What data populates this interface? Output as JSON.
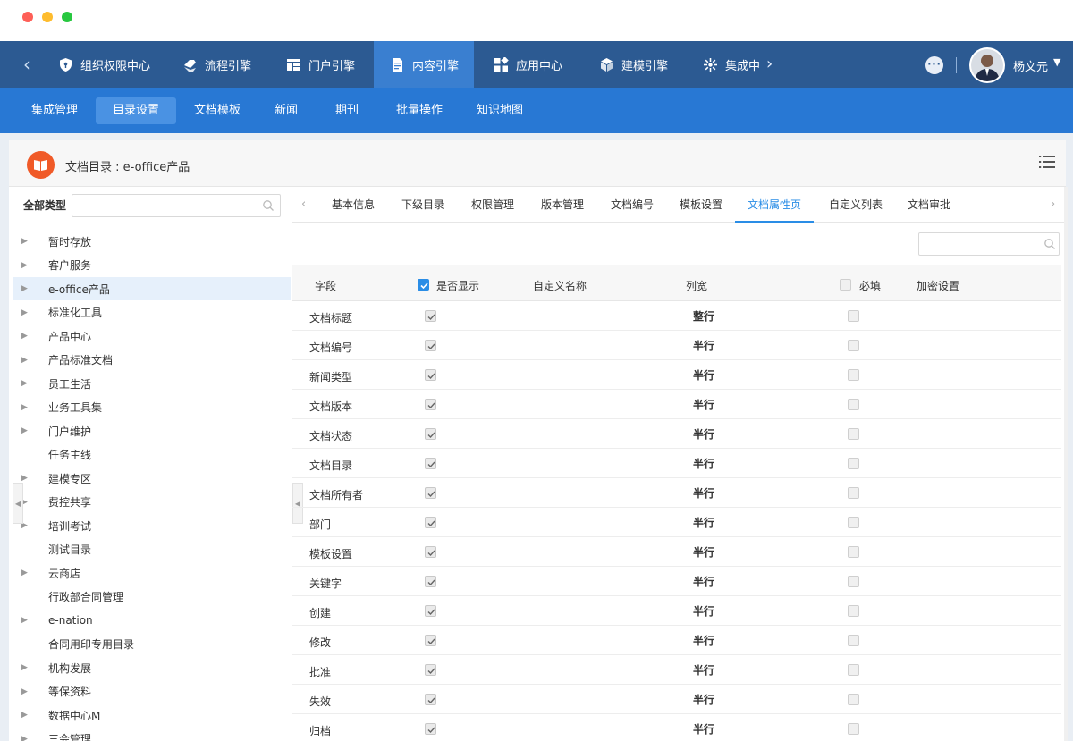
{
  "topnav": {
    "items": [
      {
        "label": "组织权限中心",
        "icon": "shield-icon"
      },
      {
        "label": "流程引擎",
        "icon": "workflow-icon"
      },
      {
        "label": "门户引擎",
        "icon": "portal-icon"
      },
      {
        "label": "内容引擎",
        "icon": "document-icon",
        "active": true
      },
      {
        "label": "应用中心",
        "icon": "apps-icon"
      },
      {
        "label": "建模引擎",
        "icon": "cube-icon"
      },
      {
        "label": "集成中",
        "icon": "integration-icon"
      }
    ],
    "user_name": "杨文元",
    "chat_icon": "more-dots-icon"
  },
  "subnav": {
    "items": [
      {
        "label": "集成管理"
      },
      {
        "label": "目录设置",
        "active": true
      },
      {
        "label": "文档模板"
      },
      {
        "label": "新闻"
      },
      {
        "label": "期刊"
      },
      {
        "label": "批量操作"
      },
      {
        "label": "知识地图"
      }
    ]
  },
  "panel": {
    "title": "文档目录 : e-office产品"
  },
  "tree": {
    "label": "全部类型",
    "search_placeholder": "",
    "items": [
      {
        "label": "暂时存放",
        "expandable": true
      },
      {
        "label": "客户服务",
        "expandable": true
      },
      {
        "label": "e-office产品",
        "expandable": true,
        "selected": true
      },
      {
        "label": "标准化工具",
        "expandable": true
      },
      {
        "label": "产品中心",
        "expandable": true
      },
      {
        "label": "产品标准文档",
        "expandable": true
      },
      {
        "label": "员工生活",
        "expandable": true
      },
      {
        "label": "业务工具集",
        "expandable": true
      },
      {
        "label": "门户维护",
        "expandable": true
      },
      {
        "label": "任务主线",
        "expandable": false
      },
      {
        "label": "建模专区",
        "expandable": true
      },
      {
        "label": "费控共享",
        "expandable": true
      },
      {
        "label": "培训考试",
        "expandable": true
      },
      {
        "label": "测试目录",
        "expandable": false
      },
      {
        "label": "云商店",
        "expandable": true
      },
      {
        "label": "行政部合同管理",
        "expandable": false
      },
      {
        "label": "e-nation",
        "expandable": true
      },
      {
        "label": "合同用印专用目录",
        "expandable": false
      },
      {
        "label": "机构发展",
        "expandable": true
      },
      {
        "label": "等保资料",
        "expandable": true
      },
      {
        "label": "数据中心M",
        "expandable": true
      },
      {
        "label": "三会管理",
        "expandable": true
      }
    ]
  },
  "tabs": {
    "items": [
      {
        "label": "基本信息"
      },
      {
        "label": "下级目录"
      },
      {
        "label": "权限管理"
      },
      {
        "label": "版本管理"
      },
      {
        "label": "文档编号"
      },
      {
        "label": "模板设置"
      },
      {
        "label": "文档属性页",
        "active": true
      },
      {
        "label": "自定义列表"
      },
      {
        "label": "文档审批"
      }
    ]
  },
  "grid": {
    "filter_placeholder": "",
    "headers": {
      "field": "字段",
      "show": "是否显示",
      "custom_name": "自定义名称",
      "width": "列宽",
      "required": "必填",
      "encrypt": "加密设置"
    },
    "header_show_checked": true,
    "header_required_checked": false,
    "rows": [
      {
        "field": "文档标题",
        "show": true,
        "width": "整行",
        "required": false
      },
      {
        "field": "文档编号",
        "show": true,
        "width": "半行",
        "required": false
      },
      {
        "field": "新闻类型",
        "show": true,
        "width": "半行",
        "required": false
      },
      {
        "field": "文档版本",
        "show": true,
        "width": "半行",
        "required": false
      },
      {
        "field": "文档状态",
        "show": true,
        "width": "半行",
        "required": false
      },
      {
        "field": "文档目录",
        "show": true,
        "width": "半行",
        "required": false
      },
      {
        "field": "文档所有者",
        "show": true,
        "width": "半行",
        "required": false
      },
      {
        "field": "部门",
        "show": true,
        "width": "半行",
        "required": false
      },
      {
        "field": "模板设置",
        "show": true,
        "width": "半行",
        "required": false
      },
      {
        "field": "关键字",
        "show": true,
        "width": "半行",
        "required": false
      },
      {
        "field": "创建",
        "show": true,
        "width": "半行",
        "required": false
      },
      {
        "field": "修改",
        "show": true,
        "width": "半行",
        "required": false
      },
      {
        "field": "批准",
        "show": true,
        "width": "半行",
        "required": false
      },
      {
        "field": "失效",
        "show": true,
        "width": "半行",
        "required": false
      },
      {
        "field": "归档",
        "show": true,
        "width": "半行",
        "required": false
      }
    ]
  },
  "colors": {
    "topnav_bg": "#2c5a92",
    "topnav_active": "#3a7fd0",
    "subnav_bg": "#2878d4",
    "accent": "#2a8de6",
    "book_icon": "#f05a28"
  }
}
